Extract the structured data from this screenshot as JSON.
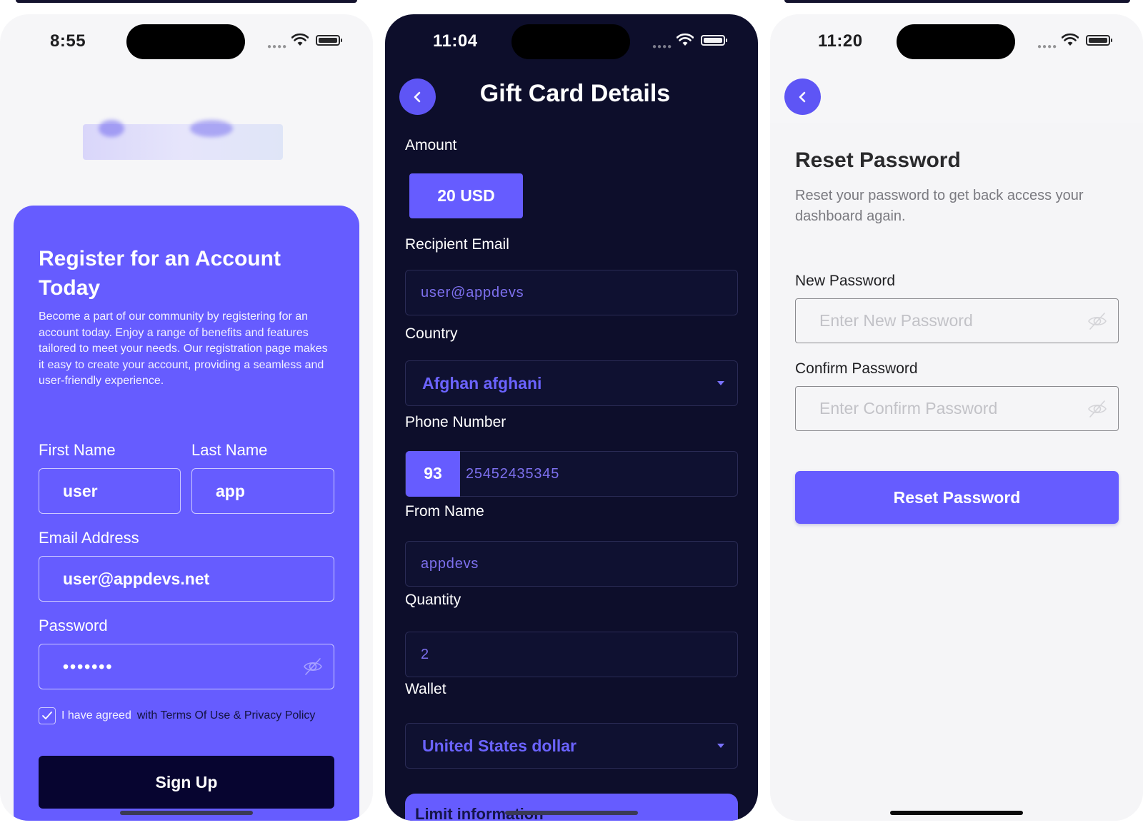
{
  "colors": {
    "accent": "#665cff",
    "dark_bg": "#0d0e2b",
    "light_bg": "#f6f6f8",
    "signup_btn": "#070530"
  },
  "screens": {
    "register": {
      "time": "8:55",
      "title": "Register for an Account Today",
      "description": "Become a part of our community by registering for an account today. Enjoy a range of benefits and features tailored to meet your needs. Our registration page makes it easy to create your account, providing a seamless and user-friendly experience.",
      "first_name_label": "First Name",
      "first_name_value": "user",
      "last_name_label": "Last Name",
      "last_name_value": "app",
      "email_label": "Email Address",
      "email_value": "user@appdevs.net",
      "password_label": "Password",
      "password_value": "•••••••",
      "agree_prefix": "I have agreed",
      "agree_link": "with Terms Of Use & Privacy Policy",
      "agree_checked": true,
      "signup_label": "Sign Up"
    },
    "gift_card": {
      "time": "11:04",
      "title": "Gift Card Details",
      "amount_label": "Amount",
      "amount_value": "20 USD",
      "recipient_email_label": "Recipient Email",
      "recipient_email_value": "user@appdevs",
      "country_label": "Country",
      "country_value": "Afghan afghani",
      "phone_label": "Phone Number",
      "phone_code": "93",
      "phone_value": "25452435345",
      "from_name_label": "From Name",
      "from_name_value": "appdevs",
      "quantity_label": "Quantity",
      "quantity_value": "2",
      "wallet_label": "Wallet",
      "wallet_value": "United States dollar",
      "limit_label": "Limit information"
    },
    "reset": {
      "time": "11:20",
      "title": "Reset Password",
      "description": "Reset your password to get back access your dashboard again.",
      "new_password_label": "New Password",
      "new_password_placeholder": "Enter New Password",
      "confirm_password_label": "Confirm Password",
      "confirm_password_placeholder": "Enter Confirm Password",
      "reset_button": "Reset Password"
    }
  }
}
